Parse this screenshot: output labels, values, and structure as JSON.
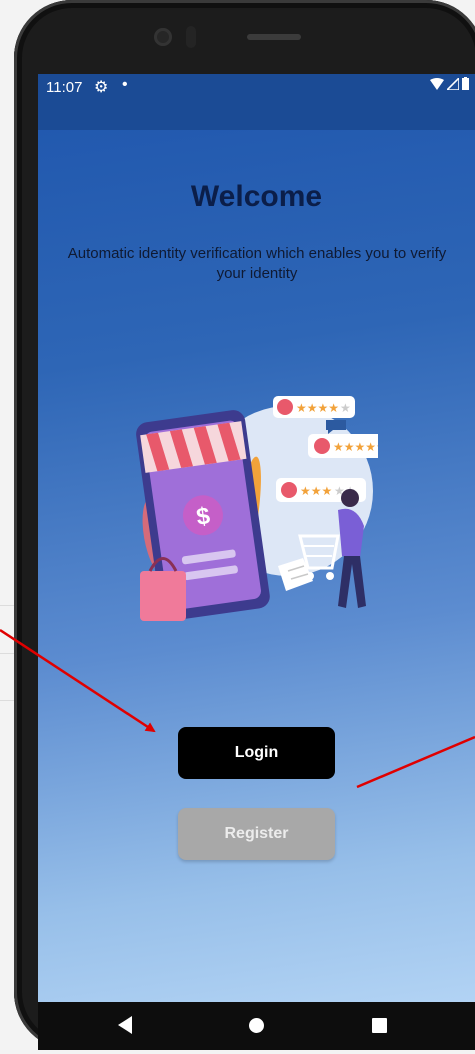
{
  "status_bar": {
    "time": "11:07",
    "settings_icon": "gear-icon",
    "notification_dot": "•",
    "wifi_icon": "wifi-icon",
    "signal_icon": "signal-icon",
    "battery_icon": "battery-icon"
  },
  "main": {
    "title": "Welcome",
    "subtitle": "Automatic identity verification which enables you to verify your identity",
    "illustration": "online-shopping-review-illustration"
  },
  "buttons": {
    "login_label": "Login",
    "register_label": "Register"
  },
  "nav_bar": {
    "back_icon": "back-triangle-icon",
    "home_icon": "home-circle-icon",
    "recents_icon": "recents-square-icon"
  },
  "colors": {
    "status_bar": "#1b4b95",
    "gradient_top": "#1f56ad",
    "gradient_bottom": "#b2d3f4",
    "title": "#0b1e49",
    "login_bg": "#000000",
    "register_bg": "#a8a8a8",
    "annotation_arrow": "#e00000"
  }
}
